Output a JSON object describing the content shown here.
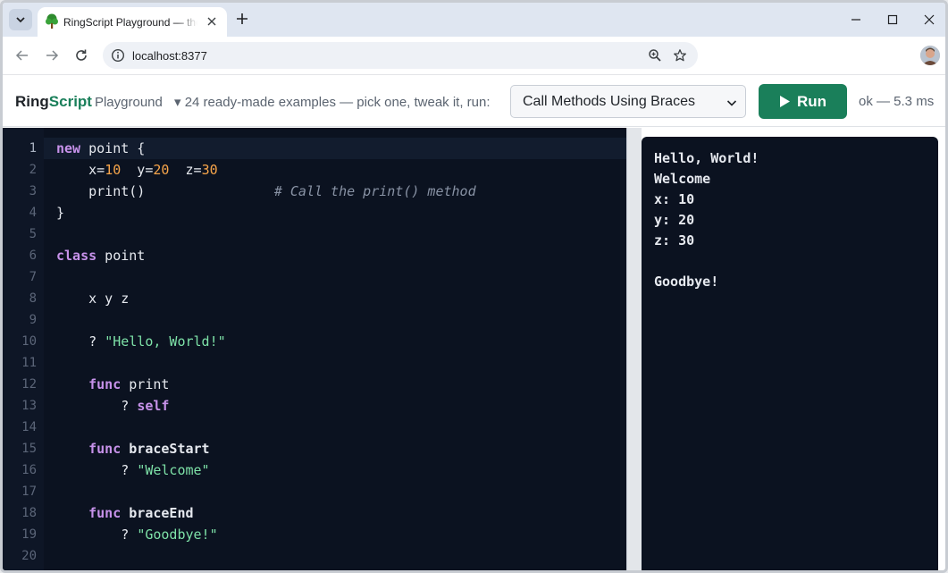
{
  "browser": {
    "tab_title": "RingScript Playground — the Ring",
    "url": "localhost:8377"
  },
  "app": {
    "brand_main": "Ring",
    "brand_accent": "Script",
    "brand_sub": "Playground",
    "hint": "▾ 24 ready-made examples — pick one, tweak it, run:",
    "example_selected": "Call Methods Using Braces",
    "run_label": "Run",
    "status": "ok — 5.3 ms",
    "colors": {
      "accent": "#1a7f5a",
      "editor_bg": "#0b1220",
      "keyword": "#c792ea",
      "number": "#f7a54a",
      "string": "#7ee2a8"
    }
  },
  "editor": {
    "line_numbers": [
      "1",
      "2",
      "3",
      "4",
      "5",
      "6",
      "7",
      "8",
      "9",
      "10",
      "11",
      "12",
      "13",
      "14",
      "15",
      "16",
      "17",
      "18",
      "19",
      "20"
    ],
    "lines": [
      [
        [
          "kw",
          "new"
        ],
        [
          "t",
          " point {"
        ]
      ],
      [
        [
          "t",
          "    x="
        ],
        [
          "num",
          "10"
        ],
        [
          "t",
          "  y="
        ],
        [
          "num",
          "20"
        ],
        [
          "t",
          "  z="
        ],
        [
          "num",
          "30"
        ]
      ],
      [
        [
          "t",
          "    print()                "
        ],
        [
          "cm",
          "# Call the print() method"
        ]
      ],
      [
        [
          "t",
          "}"
        ]
      ],
      [],
      [
        [
          "kw",
          "class"
        ],
        [
          "t",
          " point"
        ]
      ],
      [],
      [
        [
          "t",
          "    x y z"
        ]
      ],
      [],
      [
        [
          "t",
          "    ? "
        ],
        [
          "str",
          "\"Hello, World!\""
        ]
      ],
      [],
      [
        [
          "t",
          "    "
        ],
        [
          "kw",
          "func"
        ],
        [
          "t",
          " print"
        ]
      ],
      [
        [
          "t",
          "        ? "
        ],
        [
          "kw",
          "self"
        ]
      ],
      [],
      [
        [
          "t",
          "    "
        ],
        [
          "kw",
          "func"
        ],
        [
          "fn",
          " braceStart"
        ]
      ],
      [
        [
          "t",
          "        ? "
        ],
        [
          "str",
          "\"Welcome\""
        ]
      ],
      [],
      [
        [
          "t",
          "    "
        ],
        [
          "kw",
          "func"
        ],
        [
          "fn",
          " braceEnd"
        ]
      ],
      [
        [
          "t",
          "        ? "
        ],
        [
          "str",
          "\"Goodbye!\""
        ]
      ],
      []
    ]
  },
  "output": {
    "lines": [
      "Hello, World!",
      "Welcome",
      "x: 10",
      "y: 20",
      "z: 30",
      "",
      "Goodbye!"
    ]
  }
}
